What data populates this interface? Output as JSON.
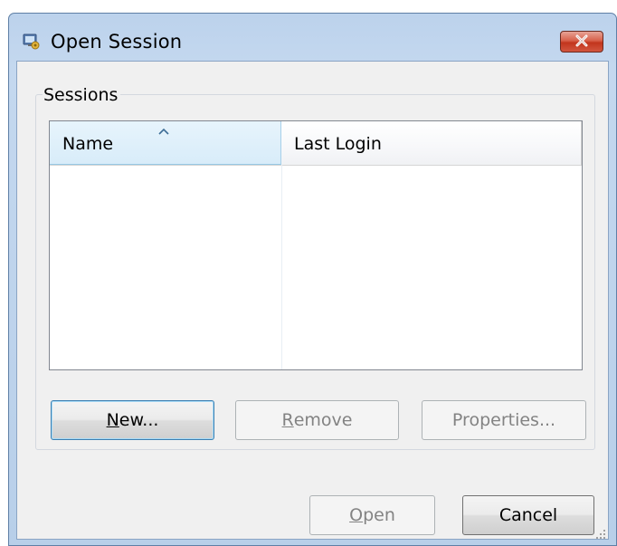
{
  "window": {
    "title": "Open Session",
    "icon": "session-app-icon",
    "close_icon": "close-icon"
  },
  "sessions": {
    "group_label": "Sessions",
    "columns": [
      {
        "label": "Name",
        "sorted": "ascending"
      },
      {
        "label": "Last Login"
      }
    ],
    "rows": []
  },
  "buttons": {
    "new": {
      "accel": "N",
      "rest": "ew...",
      "enabled": true
    },
    "remove": {
      "accel": "R",
      "rest": "emove",
      "enabled": false
    },
    "properties": {
      "label": "Properties...",
      "enabled": false
    },
    "open": {
      "accel": "O",
      "rest": "pen",
      "enabled": false
    },
    "cancel": {
      "label": "Cancel",
      "enabled": true
    }
  },
  "colors": {
    "titlebar": "#c4d8ef",
    "close_button": "#c2351d",
    "selected_header": "#d8ecf9",
    "dialog_face": "#f0f0f0"
  }
}
